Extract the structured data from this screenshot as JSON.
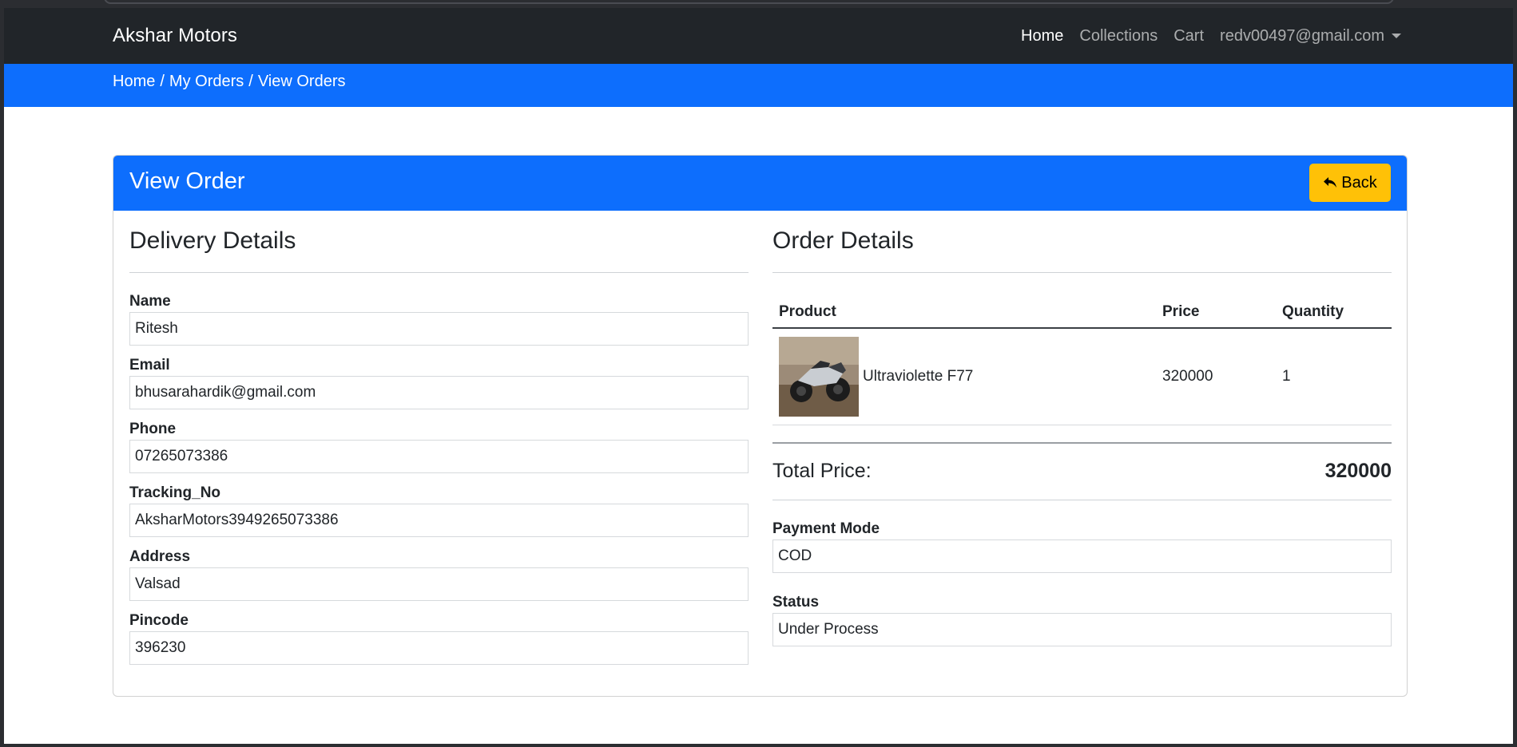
{
  "navbar": {
    "brand": "Akshar Motors",
    "links": [
      "Home",
      "Collections",
      "Cart"
    ],
    "user_email": "redv00497@gmail.com"
  },
  "breadcrumb": [
    "Home",
    "My Orders",
    "View Orders"
  ],
  "card": {
    "title": "View Order",
    "back_label": "Back"
  },
  "delivery": {
    "title": "Delivery Details",
    "fields": [
      {
        "label": "Name",
        "value": "Ritesh"
      },
      {
        "label": "Email",
        "value": "bhusarahardik@gmail.com"
      },
      {
        "label": "Phone",
        "value": "07265073386"
      },
      {
        "label": "Tracking_No",
        "value": "AksharMotors3949265073386"
      },
      {
        "label": "Address",
        "value": "Valsad"
      },
      {
        "label": "Pincode",
        "value": "396230"
      }
    ]
  },
  "order": {
    "title": "Order Details",
    "columns": [
      "Product",
      "Price",
      "Quantity"
    ],
    "items": [
      {
        "product": "Ultraviolette F77",
        "price": "320000",
        "quantity": "1"
      }
    ],
    "total_label": "Total Price:",
    "total_value": "320000",
    "payment_mode_label": "Payment Mode",
    "payment_mode": "COD",
    "status_label": "Status",
    "status": "Under Process"
  },
  "colors": {
    "navbar_bg": "#212529",
    "primary": "#0d6efd",
    "warning": "#ffc107"
  },
  "icons": {
    "back": "reply-arrow-icon",
    "dropdown": "caret-down-icon"
  }
}
